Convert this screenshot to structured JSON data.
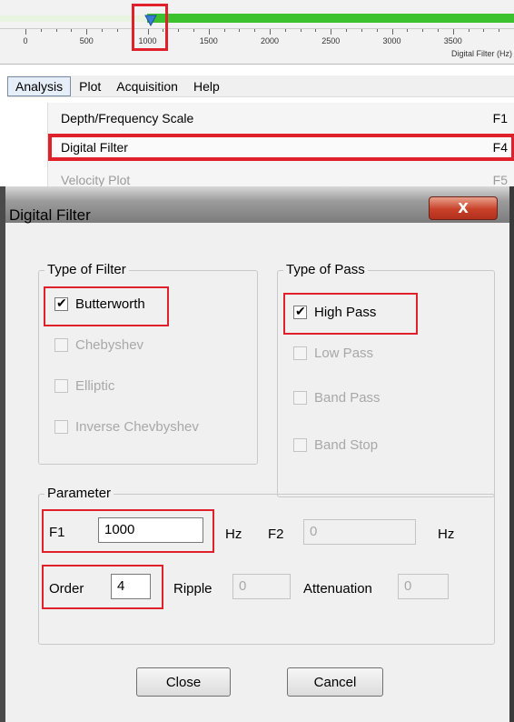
{
  "ruler": {
    "ticks": [
      "0",
      "500",
      "1000",
      "1500",
      "2000",
      "2500",
      "3000",
      "3500"
    ],
    "axis_label": "Digital Filter (Hz)",
    "marker_value_hz": 1000,
    "colors": {
      "passband": "#3cc22f",
      "stopband": "#e9f4e0",
      "marker": "#3a7bd5",
      "highlight": "#e0202a"
    }
  },
  "menubar": {
    "items": [
      "Analysis",
      "Plot",
      "Acquisition",
      "Help"
    ]
  },
  "menu": {
    "items": [
      {
        "label": "Depth/Frequency Scale",
        "shortcut": "F1"
      },
      {
        "label": "Digital Filter",
        "shortcut": "F4"
      },
      {
        "label": "Velocity Plot",
        "shortcut": "F5"
      }
    ]
  },
  "dialog": {
    "title": "Digital Filter",
    "close_glyph": "X",
    "type_of_filter": {
      "title": "Type of Filter",
      "options": [
        {
          "label": "Butterworth",
          "checked": true
        },
        {
          "label": "Chebyshev",
          "checked": false
        },
        {
          "label": "Elliptic",
          "checked": false
        },
        {
          "label": "Inverse Chevbyshev",
          "checked": false
        }
      ]
    },
    "type_of_pass": {
      "title": "Type of Pass",
      "options": [
        {
          "label": "High Pass",
          "checked": true
        },
        {
          "label": "Low Pass",
          "checked": false
        },
        {
          "label": "Band Pass",
          "checked": false
        },
        {
          "label": "Band Stop",
          "checked": false
        }
      ]
    },
    "parameter": {
      "title": "Parameter",
      "f1_label": "F1",
      "f1_value": "1000",
      "f1_unit": "Hz",
      "f2_label": "F2",
      "f2_value": "0",
      "f2_unit": "Hz",
      "order_label": "Order",
      "order_value": "4",
      "ripple_label": "Ripple",
      "ripple_value": "0",
      "attenuation_label": "Attenuation",
      "attenuation_value": "0"
    },
    "buttons": {
      "close": "Close",
      "cancel": "Cancel"
    }
  }
}
